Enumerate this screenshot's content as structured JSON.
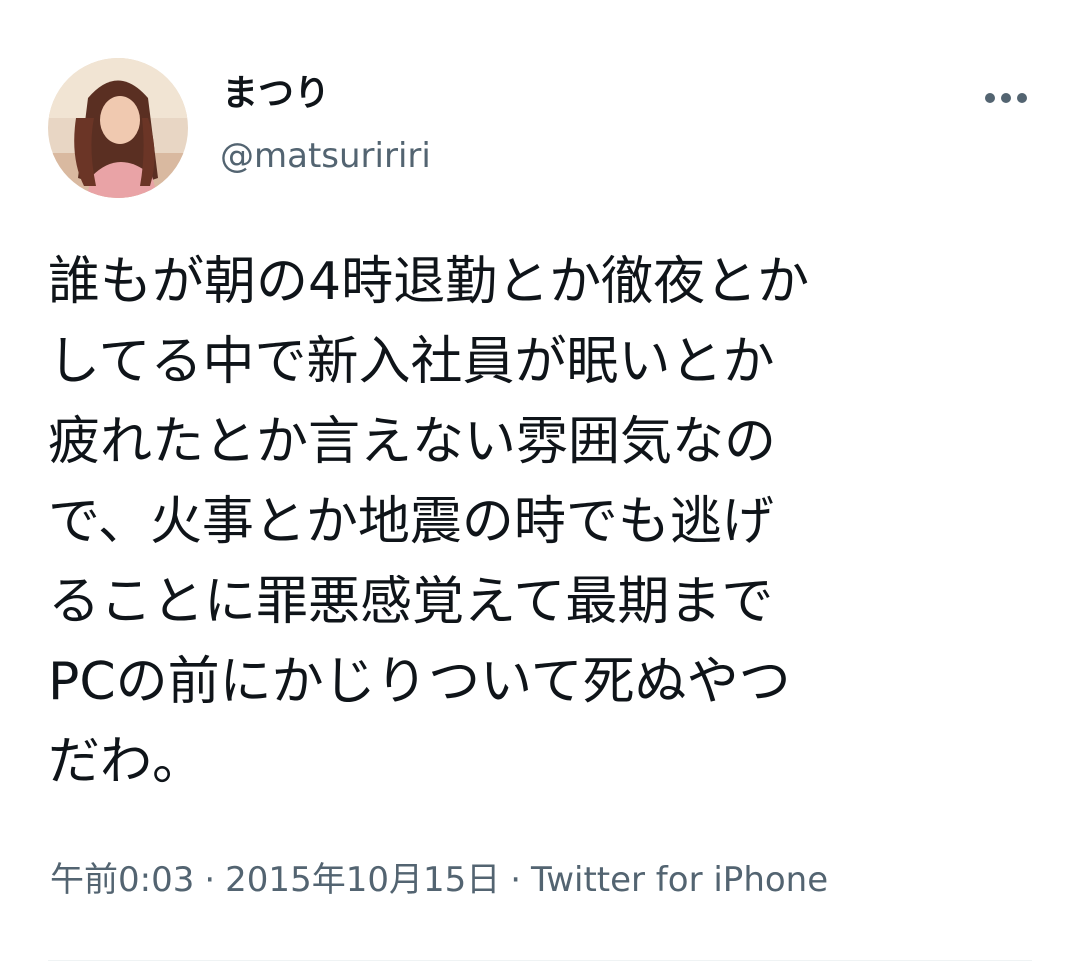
{
  "user": {
    "display_name": "まつり",
    "handle": "@matsuririri",
    "avatar": "avatar-photo"
  },
  "tweet": {
    "lines": [
      "誰もが朝の4時退勤とか徹夜とか",
      "してる中で新入社員が眠いとか",
      "疲れたとか言えない雰囲気なの",
      "で、火事とか地震の時でも逃げ",
      "ることに罪悪感覚えて最期まで",
      "PCの前にかじりついて死ぬやつ",
      "だわ。"
    ]
  },
  "meta": {
    "time": "午前0:03",
    "separator": "·",
    "date": "2015年10月15日",
    "source": "Twitter for iPhone"
  },
  "icons": {
    "more": "more-horizontal-icon"
  },
  "colors": {
    "text_primary": "#0f1419",
    "text_secondary": "#536471",
    "divider": "#eff3f4"
  }
}
